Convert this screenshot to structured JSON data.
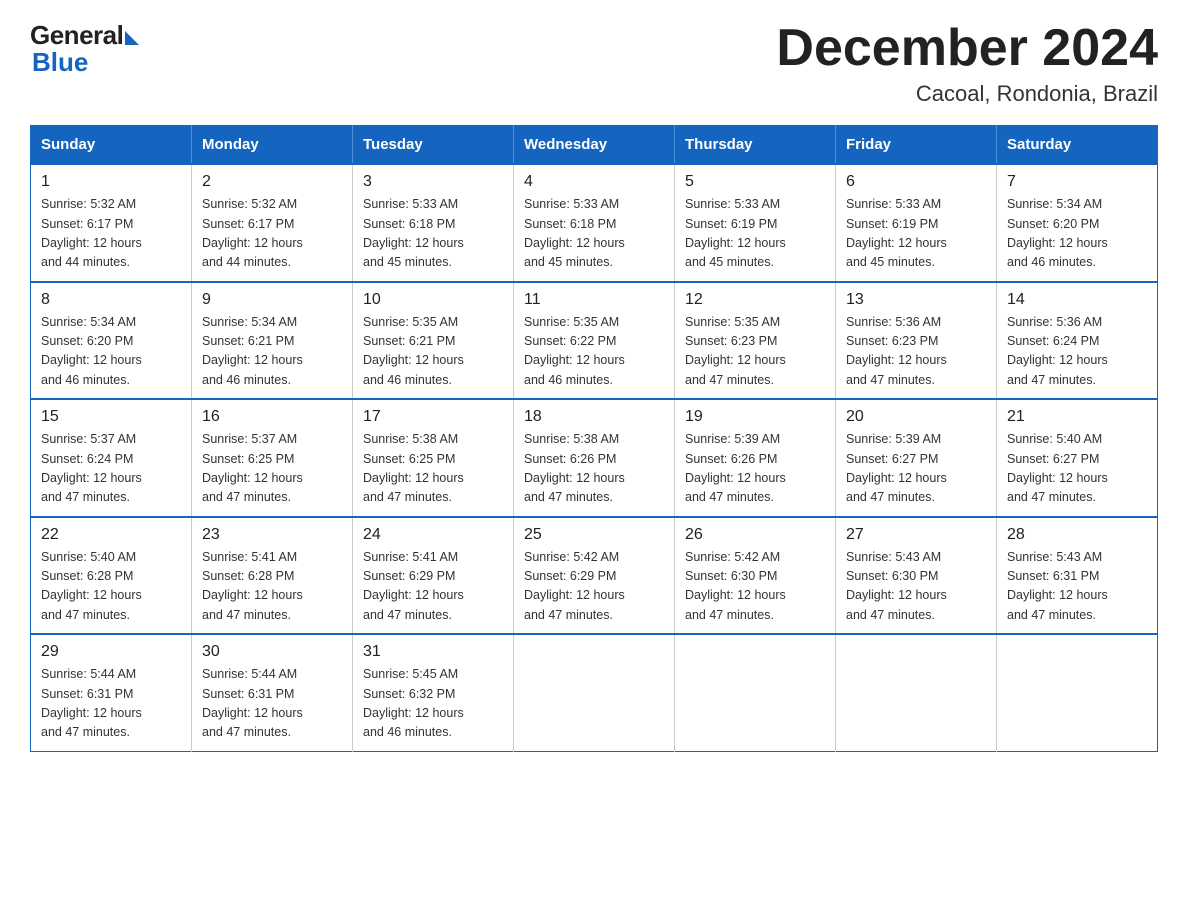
{
  "logo": {
    "general": "General",
    "blue": "Blue"
  },
  "title": "December 2024",
  "subtitle": "Cacoal, Rondonia, Brazil",
  "days_of_week": [
    "Sunday",
    "Monday",
    "Tuesday",
    "Wednesday",
    "Thursday",
    "Friday",
    "Saturday"
  ],
  "weeks": [
    [
      {
        "day": "1",
        "sunrise": "5:32 AM",
        "sunset": "6:17 PM",
        "daylight": "12 hours and 44 minutes."
      },
      {
        "day": "2",
        "sunrise": "5:32 AM",
        "sunset": "6:17 PM",
        "daylight": "12 hours and 44 minutes."
      },
      {
        "day": "3",
        "sunrise": "5:33 AM",
        "sunset": "6:18 PM",
        "daylight": "12 hours and 45 minutes."
      },
      {
        "day": "4",
        "sunrise": "5:33 AM",
        "sunset": "6:18 PM",
        "daylight": "12 hours and 45 minutes."
      },
      {
        "day": "5",
        "sunrise": "5:33 AM",
        "sunset": "6:19 PM",
        "daylight": "12 hours and 45 minutes."
      },
      {
        "day": "6",
        "sunrise": "5:33 AM",
        "sunset": "6:19 PM",
        "daylight": "12 hours and 45 minutes."
      },
      {
        "day": "7",
        "sunrise": "5:34 AM",
        "sunset": "6:20 PM",
        "daylight": "12 hours and 46 minutes."
      }
    ],
    [
      {
        "day": "8",
        "sunrise": "5:34 AM",
        "sunset": "6:20 PM",
        "daylight": "12 hours and 46 minutes."
      },
      {
        "day": "9",
        "sunrise": "5:34 AM",
        "sunset": "6:21 PM",
        "daylight": "12 hours and 46 minutes."
      },
      {
        "day": "10",
        "sunrise": "5:35 AM",
        "sunset": "6:21 PM",
        "daylight": "12 hours and 46 minutes."
      },
      {
        "day": "11",
        "sunrise": "5:35 AM",
        "sunset": "6:22 PM",
        "daylight": "12 hours and 46 minutes."
      },
      {
        "day": "12",
        "sunrise": "5:35 AM",
        "sunset": "6:23 PM",
        "daylight": "12 hours and 47 minutes."
      },
      {
        "day": "13",
        "sunrise": "5:36 AM",
        "sunset": "6:23 PM",
        "daylight": "12 hours and 47 minutes."
      },
      {
        "day": "14",
        "sunrise": "5:36 AM",
        "sunset": "6:24 PM",
        "daylight": "12 hours and 47 minutes."
      }
    ],
    [
      {
        "day": "15",
        "sunrise": "5:37 AM",
        "sunset": "6:24 PM",
        "daylight": "12 hours and 47 minutes."
      },
      {
        "day": "16",
        "sunrise": "5:37 AM",
        "sunset": "6:25 PM",
        "daylight": "12 hours and 47 minutes."
      },
      {
        "day": "17",
        "sunrise": "5:38 AM",
        "sunset": "6:25 PM",
        "daylight": "12 hours and 47 minutes."
      },
      {
        "day": "18",
        "sunrise": "5:38 AM",
        "sunset": "6:26 PM",
        "daylight": "12 hours and 47 minutes."
      },
      {
        "day": "19",
        "sunrise": "5:39 AM",
        "sunset": "6:26 PM",
        "daylight": "12 hours and 47 minutes."
      },
      {
        "day": "20",
        "sunrise": "5:39 AM",
        "sunset": "6:27 PM",
        "daylight": "12 hours and 47 minutes."
      },
      {
        "day": "21",
        "sunrise": "5:40 AM",
        "sunset": "6:27 PM",
        "daylight": "12 hours and 47 minutes."
      }
    ],
    [
      {
        "day": "22",
        "sunrise": "5:40 AM",
        "sunset": "6:28 PM",
        "daylight": "12 hours and 47 minutes."
      },
      {
        "day": "23",
        "sunrise": "5:41 AM",
        "sunset": "6:28 PM",
        "daylight": "12 hours and 47 minutes."
      },
      {
        "day": "24",
        "sunrise": "5:41 AM",
        "sunset": "6:29 PM",
        "daylight": "12 hours and 47 minutes."
      },
      {
        "day": "25",
        "sunrise": "5:42 AM",
        "sunset": "6:29 PM",
        "daylight": "12 hours and 47 minutes."
      },
      {
        "day": "26",
        "sunrise": "5:42 AM",
        "sunset": "6:30 PM",
        "daylight": "12 hours and 47 minutes."
      },
      {
        "day": "27",
        "sunrise": "5:43 AM",
        "sunset": "6:30 PM",
        "daylight": "12 hours and 47 minutes."
      },
      {
        "day": "28",
        "sunrise": "5:43 AM",
        "sunset": "6:31 PM",
        "daylight": "12 hours and 47 minutes."
      }
    ],
    [
      {
        "day": "29",
        "sunrise": "5:44 AM",
        "sunset": "6:31 PM",
        "daylight": "12 hours and 47 minutes."
      },
      {
        "day": "30",
        "sunrise": "5:44 AM",
        "sunset": "6:31 PM",
        "daylight": "12 hours and 47 minutes."
      },
      {
        "day": "31",
        "sunrise": "5:45 AM",
        "sunset": "6:32 PM",
        "daylight": "12 hours and 46 minutes."
      },
      null,
      null,
      null,
      null
    ]
  ],
  "labels": {
    "sunrise": "Sunrise:",
    "sunset": "Sunset:",
    "daylight": "Daylight:"
  }
}
